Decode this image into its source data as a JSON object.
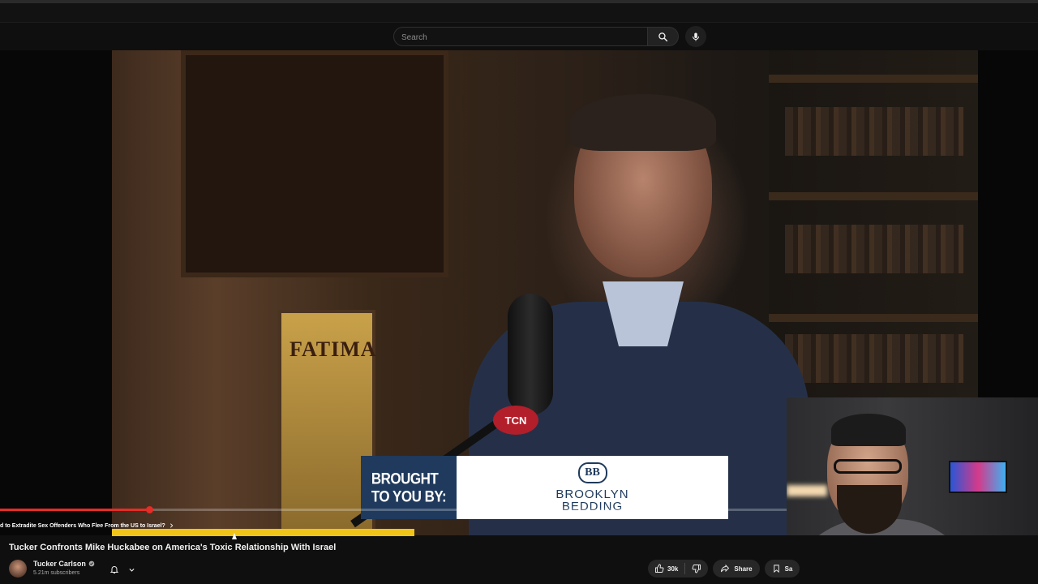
{
  "search": {
    "placeholder": "Search"
  },
  "video": {
    "poster_text": "FATIMA",
    "mic_logo_text": "TCN",
    "sponsor": {
      "left_text": "BROUGHT\nTO YOU BY:",
      "monogram": "BB",
      "brand": "BROOKLYN\nBEDDING"
    },
    "progress_fraction": 0.19
  },
  "chapter": {
    "label": "d to Extradite Sex Offenders Who Flee From the US to Israel?"
  },
  "title": "Tucker Confronts Mike Huckabee on America's Toxic Relationship With Israel",
  "channel": {
    "name": "Tucker Carlson",
    "subscribers": "5.21m subscribers"
  },
  "actions": {
    "likes": "30k",
    "share": "Share",
    "save": "Sa"
  },
  "colors": {
    "progress": "#e52d27",
    "highlight": "#f0c419",
    "sponsor_navy": "#1f3a5c"
  },
  "icons": [
    "search-icon",
    "mic-icon",
    "verified-icon",
    "bell-icon",
    "chevron-down-icon",
    "thumb-up-icon",
    "thumb-down-icon",
    "share-icon",
    "bookmark-icon",
    "chevron-right-icon"
  ]
}
